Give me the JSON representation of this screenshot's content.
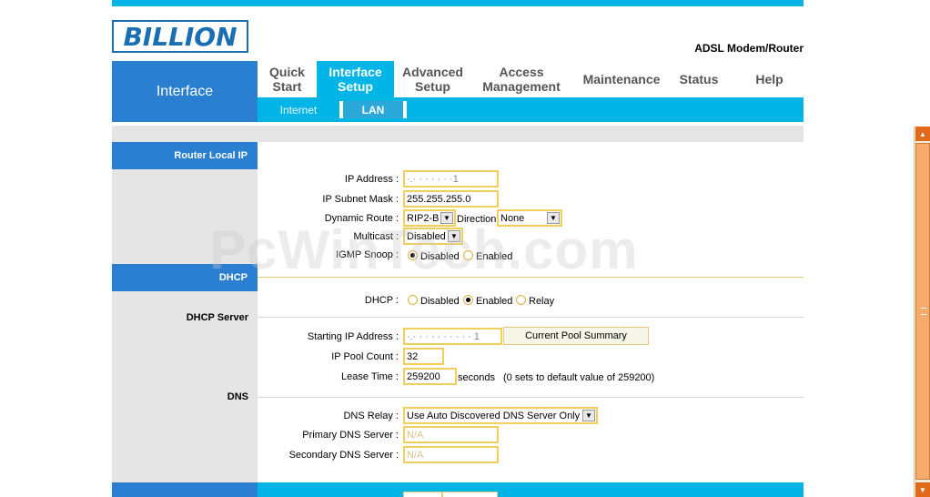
{
  "brand": {
    "logo_text": "BILLION",
    "product": "ADSL Modem/Router"
  },
  "nav": {
    "section": "Interface",
    "tabs": [
      {
        "label_1": "Quick",
        "label_2": "Start"
      },
      {
        "label_1": "Interface",
        "label_2": "Setup"
      },
      {
        "label_1": "Advanced",
        "label_2": "Setup"
      },
      {
        "label_1": "Access",
        "label_2": "Management"
      },
      {
        "label_1": "Maintenance",
        "label_2": ""
      },
      {
        "label_1": "Status",
        "label_2": ""
      },
      {
        "label_1": "Help",
        "label_2": ""
      }
    ],
    "active_tab": "Interface Setup",
    "subtabs": [
      "Internet",
      "LAN"
    ],
    "active_subtab": "LAN"
  },
  "sections": {
    "router_local_ip": "Router Local IP",
    "dhcp": "DHCP",
    "dhcp_server": "DHCP Server",
    "dns": "DNS"
  },
  "router": {
    "ip_address_label": "IP Address :",
    "ip_address_value": "·.·  ·  ·  · ·  ·  ·1",
    "subnet_label": "IP Subnet Mask :",
    "subnet_value": "255.255.255.0",
    "dynamic_route_label": "Dynamic Route :",
    "dynamic_route_value": "RIP2-B",
    "direction_label": "Direction",
    "direction_value": "None",
    "multicast_label": "Multicast :",
    "multicast_value": "Disabled",
    "igmp_label": "IGMP Snoop :",
    "igmp_disabled": "Disabled",
    "igmp_enabled": "Enabled"
  },
  "dhcp": {
    "dhcp_label": "DHCP :",
    "opt_disabled": "Disabled",
    "opt_enabled": "Enabled",
    "opt_relay": "Relay",
    "starting_ip_label": "Starting IP Address :",
    "starting_ip_value": "·.·  ·  ·  · · · · · ·  ·  1",
    "pool_summary_button": "Current Pool Summary",
    "pool_count_label": "IP Pool Count :",
    "pool_count_value": "32",
    "lease_label": "Lease Time :",
    "lease_value": "259200",
    "lease_unit": "seconds",
    "lease_hint": "(0 sets to default value of 259200)"
  },
  "dns": {
    "relay_label": "DNS Relay :",
    "relay_value": "Use Auto Discovered DNS Server Only",
    "primary_label": "Primary DNS Server :",
    "primary_value": "N/A",
    "secondary_label": "Secondary DNS Server :",
    "secondary_value": "N/A"
  },
  "watermark": "PcWinTech.com",
  "colors": {
    "accent": "#00b4e6",
    "brand_blue": "#2b7fd0",
    "field_border": "#f2cf5a"
  }
}
